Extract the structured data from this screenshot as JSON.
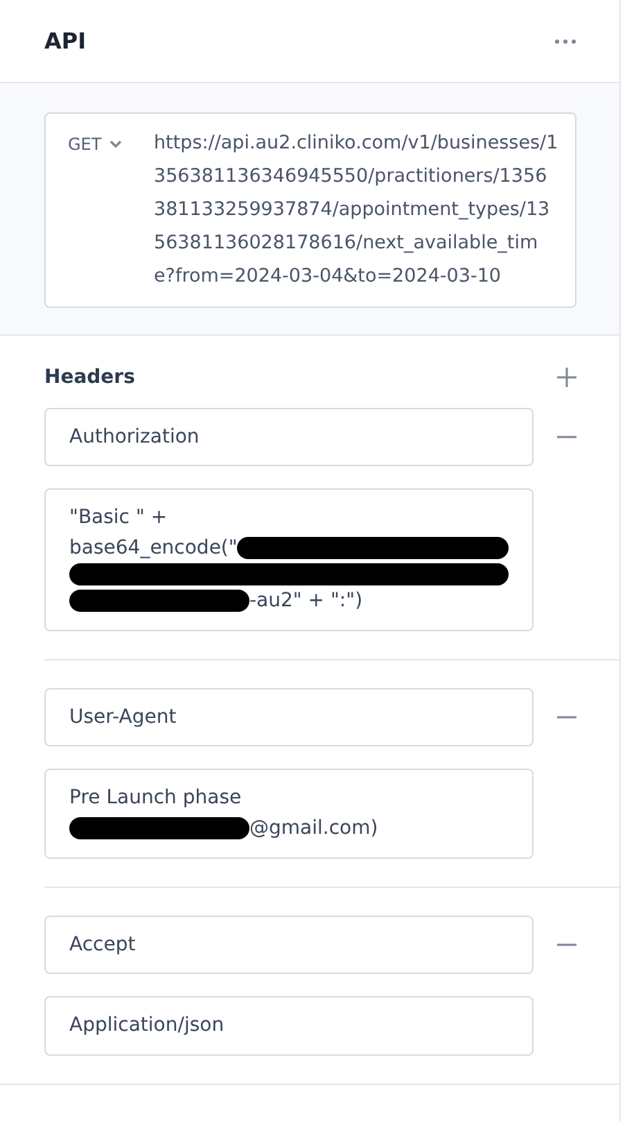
{
  "panel": {
    "title": "API"
  },
  "request": {
    "method": "GET",
    "url": "https://api.au2.cliniko.com/v1/businesses/1356381136346945550/practitioners/1356381133259937874/appointment_types/1356381136028178616/next_available_time?from=2024-03-04&to=2024-03-10"
  },
  "headers": {
    "title": "Headers",
    "items": [
      {
        "name": "Authorization",
        "value_lines": [
          [
            {
              "kind": "text",
              "text": "\"Basic \" +"
            }
          ],
          [
            {
              "kind": "text",
              "text": "base64_encode(\""
            },
            {
              "kind": "redacted"
            }
          ],
          [
            {
              "kind": "redacted"
            }
          ],
          [
            {
              "kind": "redacted"
            },
            {
              "kind": "text",
              "text": "-au2\" + \":\")"
            }
          ]
        ]
      },
      {
        "name": "User-Agent",
        "value_lines": [
          [
            {
              "kind": "text",
              "text": "Pre Launch phase"
            }
          ],
          [
            {
              "kind": "redacted"
            },
            {
              "kind": "text",
              "text": "@gmail.com)"
            }
          ]
        ]
      },
      {
        "name": "Accept",
        "value_lines": [
          [
            {
              "kind": "text",
              "text": "Application/json"
            }
          ]
        ]
      }
    ]
  }
}
